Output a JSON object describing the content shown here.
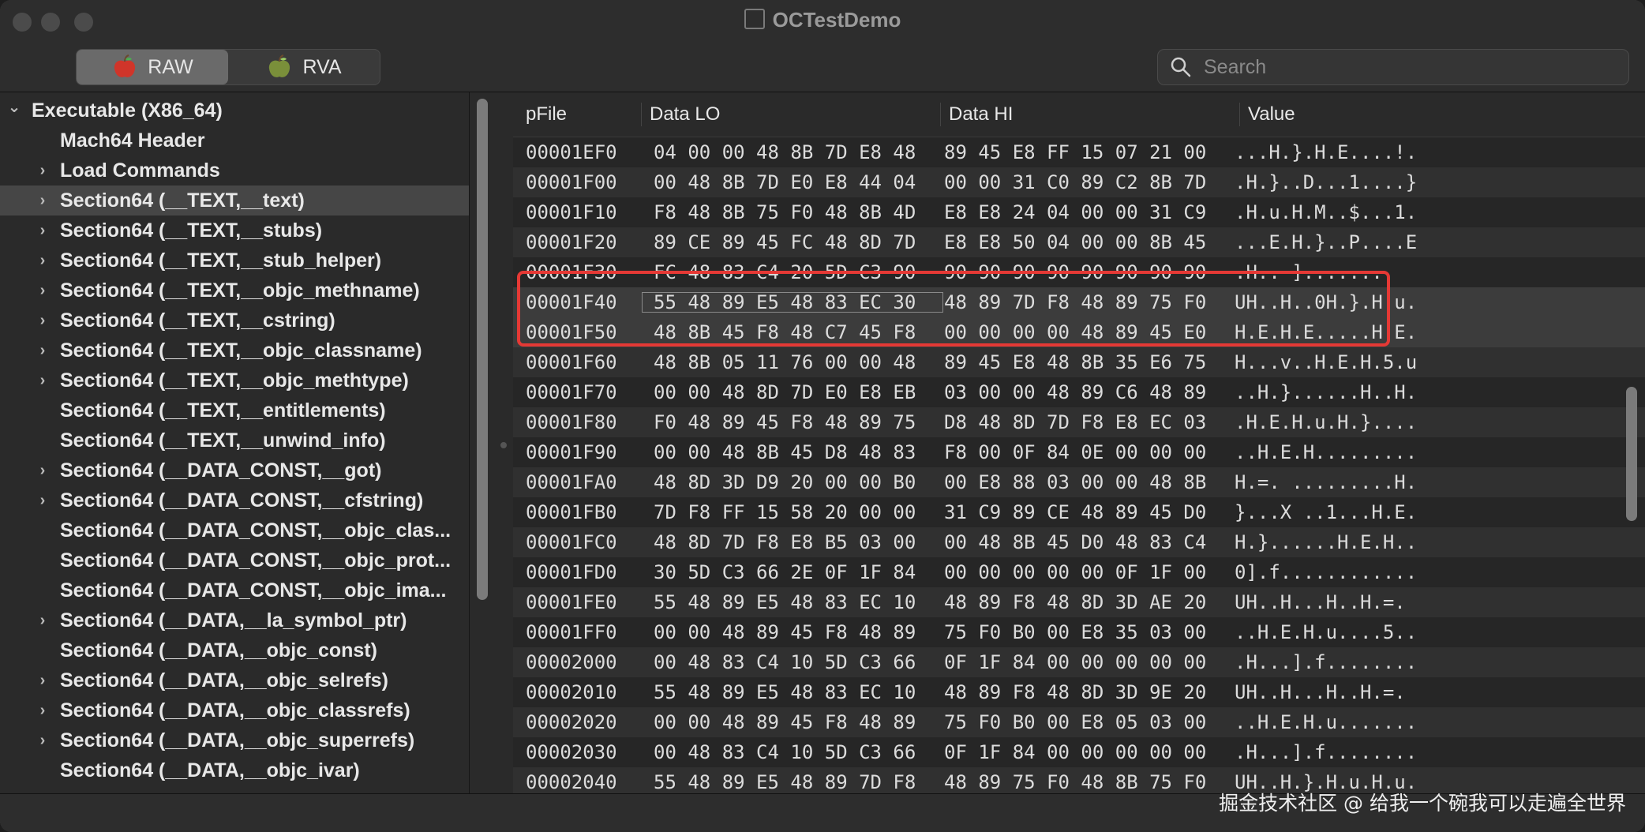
{
  "window": {
    "title": "OCTestDemo"
  },
  "toolbar": {
    "raw_label": "RAW",
    "rva_label": "RVA",
    "search_placeholder": "Search"
  },
  "sidebar": {
    "items": [
      {
        "label": "Executable  (X86_64)",
        "chevron": "down",
        "indent": 0,
        "selected": false
      },
      {
        "label": "Mach64 Header",
        "chevron": "none",
        "indent": 1,
        "selected": false
      },
      {
        "label": "Load Commands",
        "chevron": "right",
        "indent": 1,
        "selected": false
      },
      {
        "label": "Section64 (__TEXT,__text)",
        "chevron": "right",
        "indent": 1,
        "selected": true
      },
      {
        "label": "Section64 (__TEXT,__stubs)",
        "chevron": "right",
        "indent": 1,
        "selected": false
      },
      {
        "label": "Section64 (__TEXT,__stub_helper)",
        "chevron": "right",
        "indent": 1,
        "selected": false
      },
      {
        "label": "Section64 (__TEXT,__objc_methname)",
        "chevron": "right",
        "indent": 1,
        "selected": false
      },
      {
        "label": "Section64 (__TEXT,__cstring)",
        "chevron": "right",
        "indent": 1,
        "selected": false
      },
      {
        "label": "Section64 (__TEXT,__objc_classname)",
        "chevron": "right",
        "indent": 1,
        "selected": false
      },
      {
        "label": "Section64 (__TEXT,__objc_methtype)",
        "chevron": "right",
        "indent": 1,
        "selected": false
      },
      {
        "label": "Section64 (__TEXT,__entitlements)",
        "chevron": "none",
        "indent": 1,
        "selected": false
      },
      {
        "label": "Section64 (__TEXT,__unwind_info)",
        "chevron": "none",
        "indent": 1,
        "selected": false
      },
      {
        "label": "Section64 (__DATA_CONST,__got)",
        "chevron": "right",
        "indent": 1,
        "selected": false
      },
      {
        "label": "Section64 (__DATA_CONST,__cfstring)",
        "chevron": "right",
        "indent": 1,
        "selected": false
      },
      {
        "label": "Section64 (__DATA_CONST,__objc_clas...",
        "chevron": "none",
        "indent": 1,
        "selected": false
      },
      {
        "label": "Section64 (__DATA_CONST,__objc_prot...",
        "chevron": "none",
        "indent": 1,
        "selected": false
      },
      {
        "label": "Section64 (__DATA_CONST,__objc_ima...",
        "chevron": "none",
        "indent": 1,
        "selected": false
      },
      {
        "label": "Section64 (__DATA,__la_symbol_ptr)",
        "chevron": "right",
        "indent": 1,
        "selected": false
      },
      {
        "label": "Section64 (__DATA,__objc_const)",
        "chevron": "none",
        "indent": 1,
        "selected": false
      },
      {
        "label": "Section64 (__DATA,__objc_selrefs)",
        "chevron": "right",
        "indent": 1,
        "selected": false
      },
      {
        "label": "Section64 (__DATA,__objc_classrefs)",
        "chevron": "right",
        "indent": 1,
        "selected": false
      },
      {
        "label": "Section64 (__DATA,__objc_superrefs)",
        "chevron": "right",
        "indent": 1,
        "selected": false
      },
      {
        "label": "Section64 (__DATA,__objc_ivar)",
        "chevron": "none",
        "indent": 1,
        "selected": false
      }
    ]
  },
  "table": {
    "headers": [
      "pFile",
      "Data LO",
      "Data HI",
      "Value"
    ],
    "rows": [
      [
        "00001EF0",
        "04 00 00 48 8B 7D E8 48",
        "89 45 E8 FF 15 07 21 00",
        "...H.}.H.E....!."
      ],
      [
        "00001F00",
        "00 48 8B 7D E0 E8 44 04",
        "00 00 31 C0 89 C2 8B 7D",
        ".H.}..D...1....}"
      ],
      [
        "00001F10",
        "F8 48 8B 75 F0 48 8B 4D",
        "E8 E8 24 04 00 00 31 C9",
        ".H.u.H.M..$...1."
      ],
      [
        "00001F20",
        "89 CE 89 45 FC 48 8D 7D",
        "E8 E8 50 04 00 00 8B 45",
        "...E.H.}..P....E"
      ],
      [
        "00001F30",
        "FC 48 83 C4 20 5D C3 90",
        "90 90 90 90 90 90 90 90",
        ".H.. ]......."
      ],
      [
        "00001F40",
        "55 48 89 E5 48 83 EC 30",
        "48 89 7D F8 48 89 75 F0",
        "UH..H..0H.}.H.u."
      ],
      [
        "00001F50",
        "48 8B 45 F8 48 C7 45 F8",
        "00 00 00 00 48 89 45 E0",
        "H.E.H.E.....H.E."
      ],
      [
        "00001F60",
        "48 8B 05 11 76 00 00 48",
        "89 45 E8 48 8B 35 E6 75",
        "H...v..H.E.H.5.u"
      ],
      [
        "00001F70",
        "00 00 48 8D 7D E0 E8 EB",
        "03 00 00 48 89 C6 48 89",
        "..H.}......H..H."
      ],
      [
        "00001F80",
        "F0 48 89 45 F8 48 89 75",
        "D8 48 8D 7D F8 E8 EC 03",
        ".H.E.H.u.H.}...."
      ],
      [
        "00001F90",
        "00 00 48 8B 45 D8 48 83",
        "F8 00 0F 84 0E 00 00 00",
        "..H.E.H........."
      ],
      [
        "00001FA0",
        "48 8D 3D D9 20 00 00 B0",
        "00 E8 88 03 00 00 48 8B",
        "H.=. .........H."
      ],
      [
        "00001FB0",
        "7D F8 FF 15 58 20 00 00",
        "31 C9 89 CE 48 89 45 D0",
        "}...X ..1...H.E."
      ],
      [
        "00001FC0",
        "48 8D 7D F8 E8 B5 03 00",
        "00 48 8B 45 D0 48 83 C4",
        "H.}......H.E.H.."
      ],
      [
        "00001FD0",
        "30 5D C3 66 2E 0F 1F 84",
        "00 00 00 00 00 0F 1F 00",
        "0].f............"
      ],
      [
        "00001FE0",
        "55 48 89 E5 48 83 EC 10",
        "48 89 F8 48 8D 3D AE 20",
        "UH..H...H..H.=. "
      ],
      [
        "00001FF0",
        "00 00 48 89 45 F8 48 89",
        "75 F0 B0 00 E8 35 03 00",
        "..H.E.H.u....5.."
      ],
      [
        "00002000",
        "00 48 83 C4 10 5D C3 66",
        "0F 1F 84 00 00 00 00 00",
        ".H...].f........"
      ],
      [
        "00002010",
        "55 48 89 E5 48 83 EC 10",
        "48 89 F8 48 8D 3D 9E 20",
        "UH..H...H..H.=. "
      ],
      [
        "00002020",
        "00 00 48 89 45 F8 48 89",
        "75 F0 B0 00 E8 05 03 00",
        "..H.E.H.u......."
      ],
      [
        "00002030",
        "00 48 83 C4 10 5D C3 66",
        "0F 1F 84 00 00 00 00 00",
        ".H...].f........"
      ],
      [
        "00002040",
        "55 48 89 E5 48 89 7D F8",
        "48 89 75 F0 48 8B 75 F0",
        "UH..H.}.H.u.H.u."
      ]
    ]
  },
  "watermark": "掘金技术社区 @ 给我一个碗我可以走遍全世界",
  "colors": {
    "highlight_box": "#e53935",
    "selection": "#464646"
  }
}
